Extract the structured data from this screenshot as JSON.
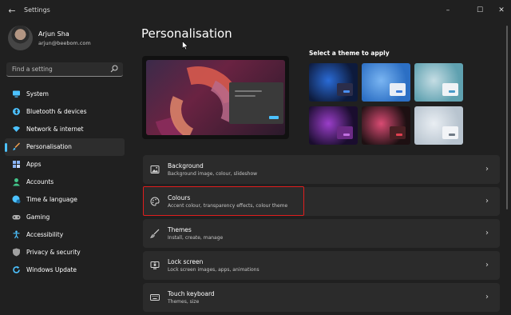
{
  "window": {
    "title": "Settings",
    "controls": [
      "minimize",
      "maximize",
      "close"
    ]
  },
  "user": {
    "name": "Arjun Sha",
    "email": "arjun@beebom.com"
  },
  "search": {
    "placeholder": "Find a setting"
  },
  "sidebar": {
    "items": [
      {
        "label": "System",
        "icon": "monitor-icon",
        "color": "#4cc2ff"
      },
      {
        "label": "Bluetooth & devices",
        "icon": "bluetooth-icon",
        "color": "#4cc2ff"
      },
      {
        "label": "Network & internet",
        "icon": "wifi-icon",
        "color": "#4cc2ff"
      },
      {
        "label": "Personalisation",
        "icon": "brush-icon",
        "color": "#f0a050",
        "active": true
      },
      {
        "label": "Apps",
        "icon": "apps-icon",
        "color": "#8ab4f8"
      },
      {
        "label": "Accounts",
        "icon": "person-icon",
        "color": "#42c58a"
      },
      {
        "label": "Time & language",
        "icon": "globe-clock-icon",
        "color": "#4cc2ff"
      },
      {
        "label": "Gaming",
        "icon": "gamepad-icon",
        "color": "#b0b0b0"
      },
      {
        "label": "Accessibility",
        "icon": "accessibility-icon",
        "color": "#4cc2ff"
      },
      {
        "label": "Privacy & security",
        "icon": "shield-icon",
        "color": "#a0a0a0"
      },
      {
        "label": "Windows Update",
        "icon": "update-icon",
        "color": "#4cc2ff"
      }
    ]
  },
  "main": {
    "title": "Personalisation",
    "theme_heading": "Select a theme to apply",
    "themes": [
      {
        "name": "windows-dark",
        "bg": "#0d1a3c",
        "accent": "#2a6bd6",
        "mini": "#2b2d4a",
        "miniAccent": "#4a8ef0"
      },
      {
        "name": "windows-light",
        "bg": "#2c6fc4",
        "accent": "#7ab5f2",
        "mini": "#e8edf5",
        "miniAccent": "#3a7ad8"
      },
      {
        "name": "glow-lake",
        "bg": "#5fa1b0",
        "accent": "#c5dde4",
        "mini": "#f0f3f6",
        "miniAccent": "#4a9ac8"
      },
      {
        "name": "captured-motion",
        "bg": "#1a0d2e",
        "accent": "#9a3ec9",
        "mini": "#6b2a85",
        "miniAccent": "#c070e0"
      },
      {
        "name": "flow",
        "bg": "#1d1012",
        "accent": "#d94b73",
        "mini": "#4a2024",
        "miniAccent": "#e04050"
      },
      {
        "name": "sunrise",
        "bg": "#b8c4cf",
        "accent": "#e9eef3",
        "mini": "#f2f4f7",
        "miniAccent": "#707a86"
      }
    ],
    "cards": [
      {
        "title": "Background",
        "subtitle": "Background image, colour, slideshow",
        "icon": "image-icon"
      },
      {
        "title": "Colours",
        "subtitle": "Accent colour, transparency effects, colour theme",
        "icon": "palette-icon"
      },
      {
        "title": "Themes",
        "subtitle": "Install, create, manage",
        "icon": "brush-icon"
      },
      {
        "title": "Lock screen",
        "subtitle": "Lock screen images, apps, animations",
        "icon": "lock-screen-icon"
      },
      {
        "title": "Touch keyboard",
        "subtitle": "Themes, size",
        "icon": "keyboard-icon"
      }
    ],
    "highlight_color": "#e01e1e",
    "accent_color": "#4cc2ff"
  }
}
